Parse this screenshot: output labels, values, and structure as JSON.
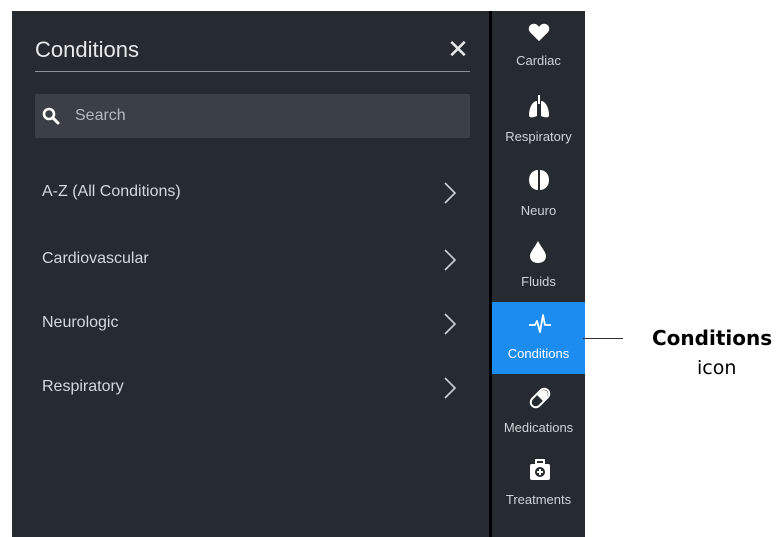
{
  "panel": {
    "title": "Conditions",
    "close_symbol": "✕",
    "search": {
      "placeholder": "Search",
      "value": ""
    },
    "items": [
      {
        "label": "A-Z (All Conditions)",
        "icon": "chevron-right-icon"
      },
      {
        "label": "Cardiovascular",
        "icon": "chevron-right-icon"
      },
      {
        "label": "Neurologic",
        "icon": "chevron-right-icon"
      },
      {
        "label": "Respiratory",
        "icon": "chevron-right-icon"
      }
    ]
  },
  "sidebar": {
    "items": [
      {
        "label": "Cardiac",
        "icon": "heart-icon",
        "active": false
      },
      {
        "label": "Respiratory",
        "icon": "lungs-icon",
        "active": false
      },
      {
        "label": "Neuro",
        "icon": "brain-icon",
        "active": false
      },
      {
        "label": "Fluids",
        "icon": "droplet-icon",
        "active": false
      },
      {
        "label": "Conditions",
        "icon": "heartbeat-icon",
        "active": true
      },
      {
        "label": "Medications",
        "icon": "pill-icon",
        "active": false
      },
      {
        "label": "Treatments",
        "icon": "medical-kit-icon",
        "active": false
      }
    ],
    "active_color": "#1d8cf0",
    "background_color": "#252b30"
  },
  "callout": {
    "title": "Conditions",
    "subtitle": "icon"
  }
}
